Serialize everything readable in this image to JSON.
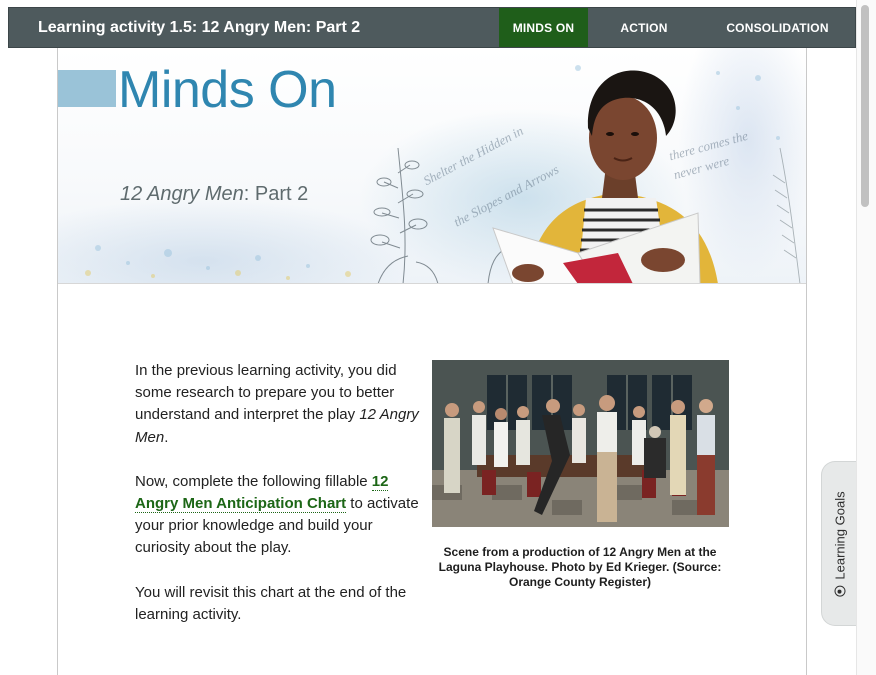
{
  "header": {
    "title": "Learning activity 1.5: 12 Angry Men: Part 2",
    "tabs": [
      {
        "label": "MINDS ON",
        "active": true
      },
      {
        "label": "ACTION",
        "active": false
      },
      {
        "label": "CONSOLIDATION",
        "active": false
      }
    ]
  },
  "hero": {
    "heading": "Minds On",
    "subtitle_italic": "12 Angry Men",
    "subtitle_rest": ": Part 2",
    "accent_color": "#2f86b0"
  },
  "content": {
    "para1_text": "In the previous learning activity, you did some research to prepare you to better understand and interpret the play ",
    "para1_italic": "12 Angry Men",
    "para1_end": ".",
    "para2_start": "Now, complete the following fillable ",
    "para2_link": "12 Angry Men Anticipation Chart",
    "para2_end": " to activate your prior knowledge and build your curiosity about the play.",
    "para3": "You will revisit this chart at the end of the learning activity."
  },
  "figure": {
    "caption": "Scene from a production of 12 Angry Men at the Laguna Playhouse. Photo by Ed Krieger. (Source: Orange County Register)"
  },
  "side_tab": {
    "label": "Learning Goals",
    "icon": "target-icon"
  },
  "colors": {
    "nav_bg": "#4e5a5d",
    "nav_active": "#1f5e1a",
    "link": "#1c6616"
  }
}
